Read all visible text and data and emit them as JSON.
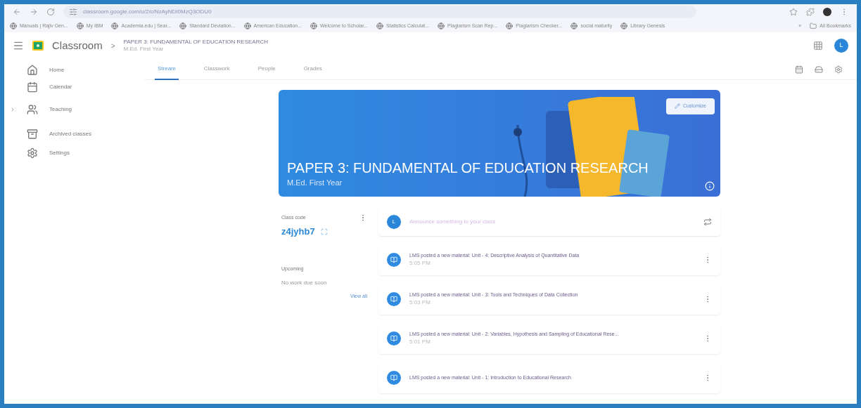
{
  "browser": {
    "url": "classroom.google.com/u/2/c/NzAyNDI0MzQ3ODU0",
    "bookmarks": [
      "Manuals | Rajiv Gen...",
      "My IBM",
      "Academia.edu | Sear...",
      "Standard Deviation...",
      "American Education...",
      "Welcome to Scholar...",
      "Statistics Calculat...",
      "Plagiarism Scan Rep...",
      "Plagiarism Checker...",
      "social maturity",
      "Library Genesis"
    ],
    "more": "»",
    "all_bookmarks": "All Bookmarks"
  },
  "header": {
    "app": "Classroom",
    "separator": ">",
    "class_title": "PAPER 3: FUNDAMENTAL OF EDUCATION RESEARCH",
    "class_subtitle": "M.Ed. First Year",
    "avatar": "L"
  },
  "sidebar": {
    "items": [
      {
        "kind": "home",
        "label": "Home",
        "expandable": false
      },
      {
        "kind": "calendar",
        "label": "Calendar",
        "expandable": false
      },
      {
        "kind": "teaching",
        "label": "Teaching",
        "expandable": true
      },
      {
        "kind": "archive",
        "label": "Archived classes",
        "expandable": false
      },
      {
        "kind": "settings",
        "label": "Settings",
        "expandable": false
      }
    ]
  },
  "tabs": [
    {
      "label": "Stream",
      "selected": true
    },
    {
      "label": "Classwork",
      "selected": false
    },
    {
      "label": "People",
      "selected": false
    },
    {
      "label": "Grades",
      "selected": false
    }
  ],
  "banner": {
    "title": "PAPER 3: FUNDAMENTAL OF EDUCATION RESEARCH",
    "subtitle": "M.Ed. First Year",
    "customize": "Customize"
  },
  "class_code": {
    "label": "Class code",
    "code": "z4jyhb7"
  },
  "upcoming": {
    "label": "Upcoming",
    "empty": "No work due soon",
    "view_all": "View all"
  },
  "announce": {
    "avatar": "L",
    "placeholder": "Announce something to your class"
  },
  "posts": [
    {
      "text": "LMS posted a new material: Unit - 4: Descriptive Analysis of Quantitative Data",
      "time": "5:05 PM"
    },
    {
      "text": "LMS posted a new material: Unit - 3: Tools and Techniques of Data Collection",
      "time": "5:03 PM"
    },
    {
      "text": "LMS posted a new material: Unit - 2: Variables, Hypothesis and Sampling of Educational Rese...",
      "time": "5:01 PM"
    },
    {
      "text": "LMS posted a new material: Unit - 1: Introduction to Educational Research"
    }
  ]
}
